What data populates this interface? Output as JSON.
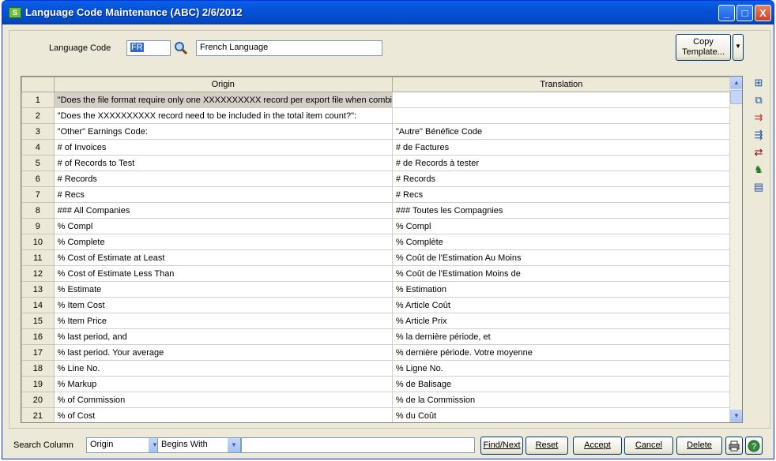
{
  "window": {
    "title": "Language Code Maintenance (ABC) 2/6/2012",
    "app_icon": "sage-green-app-icon",
    "controls": {
      "minimize": "_",
      "maximize": "□",
      "close": "X"
    }
  },
  "header": {
    "language_code_label": "Language Code",
    "language_code_value": "FR",
    "language_description": "French Language",
    "copy_template_line1": "Copy",
    "copy_template_line2": "Template..."
  },
  "grid": {
    "columns": [
      "Origin",
      "Translation"
    ],
    "rows": [
      {
        "n": "1",
        "origin": "\"Does the file format require only one XXXXXXXXXX record per export file when combini",
        "translation": "",
        "hl": true
      },
      {
        "n": "2",
        "origin": "\"Does the XXXXXXXXXX record need to be included in the total item count?\":",
        "translation": "",
        "hl": false
      },
      {
        "n": "3",
        "origin": "\"Other\" Earnings Code:",
        "translation": "\"Autre\" Bénéfice Code",
        "hl": false
      },
      {
        "n": "4",
        "origin": "# of Invoices",
        "translation": "# de Factures",
        "hl": false
      },
      {
        "n": "5",
        "origin": "# of Records to Test",
        "translation": "# de Records à tester",
        "hl": false
      },
      {
        "n": "6",
        "origin": "# Records",
        "translation": "# Records",
        "hl": false
      },
      {
        "n": "7",
        "origin": "# Recs",
        "translation": "# Recs",
        "hl": false
      },
      {
        "n": "8",
        "origin": "### All Companies",
        "translation": "### Toutes les Compagnies",
        "hl": false
      },
      {
        "n": "9",
        "origin": "% Compl",
        "translation": "% Compl",
        "hl": false
      },
      {
        "n": "10",
        "origin": "% Complete",
        "translation": "% Complète",
        "hl": false
      },
      {
        "n": "11",
        "origin": "% Cost of Estimate at Least",
        "translation": "% Coût de l'Estimation Au Moins",
        "hl": false
      },
      {
        "n": "12",
        "origin": "% Cost of Estimate Less Than",
        "translation": "% Coût de l'Estimation Moins de",
        "hl": false
      },
      {
        "n": "13",
        "origin": "% Estimate",
        "translation": "% Estimation",
        "hl": false
      },
      {
        "n": "14",
        "origin": "% Item Cost",
        "translation": "% Article Coût",
        "hl": false
      },
      {
        "n": "15",
        "origin": "% Item Price",
        "translation": "% Article Prix",
        "hl": false
      },
      {
        "n": "16",
        "origin": "% last period, and",
        "translation": "% la dernière période, et",
        "hl": false
      },
      {
        "n": "17",
        "origin": "% last period.  Your average",
        "translation": "% dernière période. Votre moyenne",
        "hl": false
      },
      {
        "n": "18",
        "origin": "% Line No.",
        "translation": "% Ligne No.",
        "hl": false
      },
      {
        "n": "19",
        "origin": "% Markup",
        "translation": "% de Balisage",
        "hl": false
      },
      {
        "n": "20",
        "origin": "% of Commission",
        "translation": "% de la Commission",
        "hl": false
      },
      {
        "n": "21",
        "origin": "% of Cost",
        "translation": "% du Coût",
        "hl": false
      }
    ]
  },
  "side_toolbar": [
    "insert-row-icon",
    "copy-row-icon",
    "move-up-icon",
    "move-down-icon",
    "find-replace-icon",
    "user-arrow-icon",
    "database-icon"
  ],
  "footer": {
    "search_column_label": "Search Column",
    "search_column_value": "Origin",
    "search_mode_value": "Begins With",
    "search_text": "",
    "find_next": "Find/Next",
    "reset": "Reset",
    "accept": "Accept",
    "cancel": "Cancel",
    "delete": "Delete"
  }
}
